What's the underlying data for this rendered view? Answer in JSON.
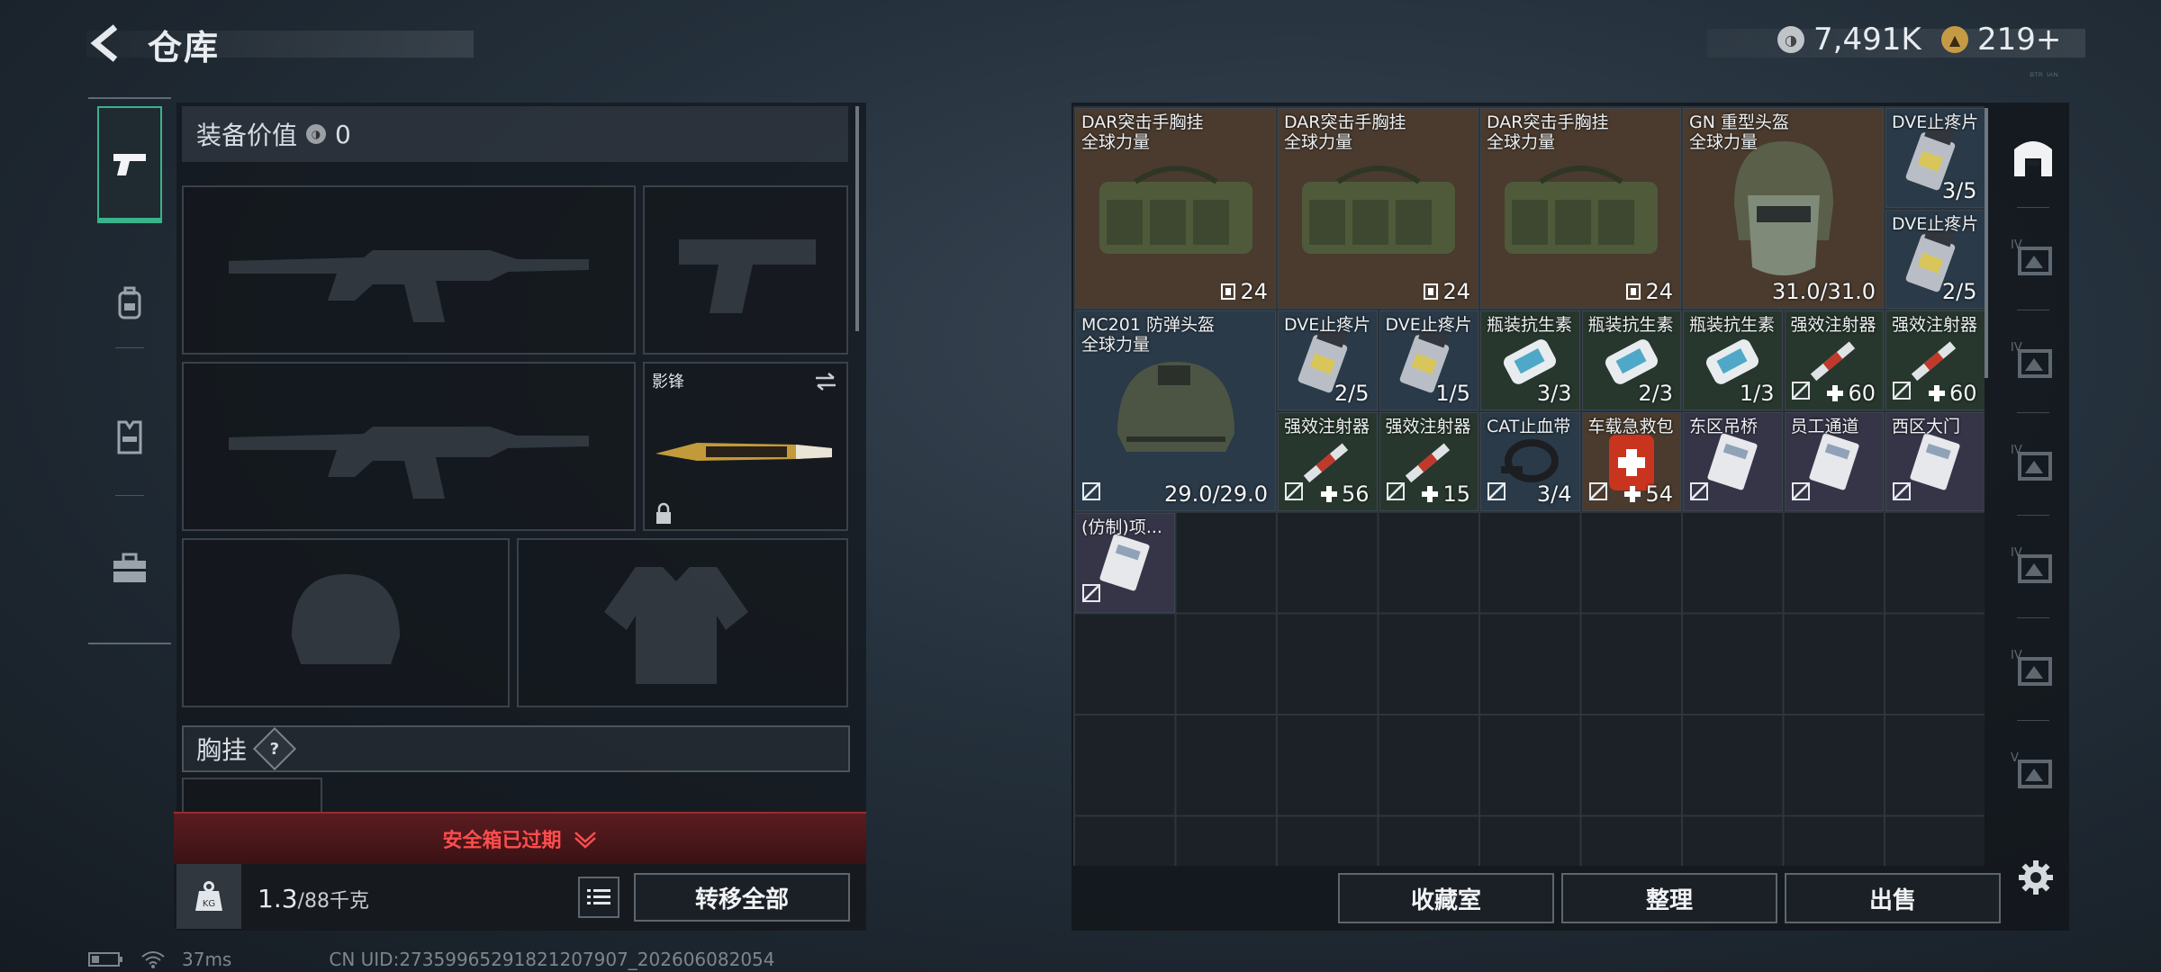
{
  "header": {
    "title": "仓库",
    "currency_coins": "7,491K",
    "currency_tokens": "219+",
    "top_tiny": "ᴮᵀᴿ ᴵᴬᴺ"
  },
  "left_rail": {
    "items": [
      {
        "name": "weapons",
        "icon": "pistol-icon",
        "active": true
      },
      {
        "name": "backpack",
        "icon": "backpack-icon",
        "active": false
      },
      {
        "name": "vest",
        "icon": "vest-icon",
        "active": false
      },
      {
        "name": "case",
        "icon": "briefcase-icon",
        "active": false
      }
    ]
  },
  "equipment": {
    "value_label": "装备价值",
    "value": "0",
    "melee_name": "影锋",
    "chest_label": "胸挂",
    "chest_help": "?",
    "safebox_expired": "安全箱已过期",
    "weight_value": "1.3",
    "weight_max": "/88千克",
    "transfer_all": "转移全部"
  },
  "status": {
    "ping": "37ms",
    "uid": "CN UID:27359965291821207907_202606082054"
  },
  "warehouse": {
    "items": [
      {
        "name": "DAR突击手胸挂",
        "sub": "全球力量",
        "count": "24",
        "kind": "bag"
      },
      {
        "name": "DAR突击手胸挂",
        "sub": "全球力量",
        "count": "24",
        "kind": "bag"
      },
      {
        "name": "DAR突击手胸挂",
        "sub": "全球力量",
        "count": "24",
        "kind": "bag"
      },
      {
        "name": "GN 重型头盔",
        "sub": "全球力量",
        "count": "31.0/31.0",
        "kind": "helmet-heavy"
      },
      {
        "name": "DVE止疼片",
        "count": "3/5",
        "kind": "pill"
      },
      {
        "name": "DVE止疼片",
        "count": "2/5",
        "kind": "pill"
      },
      {
        "name": "MC201 防弹头盔",
        "sub": "全球力量",
        "count": "29.0/29.0",
        "kind": "helmet"
      },
      {
        "name": "DVE止疼片",
        "count": "2/5",
        "kind": "pill"
      },
      {
        "name": "DVE止疼片",
        "count": "1/5",
        "kind": "pill"
      },
      {
        "name": "瓶装抗生素",
        "count": "3/3",
        "kind": "bottle"
      },
      {
        "name": "瓶装抗生素",
        "count": "2/3",
        "kind": "bottle"
      },
      {
        "name": "瓶装抗生素",
        "count": "1/3",
        "kind": "bottle"
      },
      {
        "name": "强效注射器",
        "count": "60",
        "kind": "syringe"
      },
      {
        "name": "强效注射器",
        "count": "60",
        "kind": "syringe"
      },
      {
        "name": "强效注射器",
        "count": "56",
        "kind": "syringe"
      },
      {
        "name": "强效注射器",
        "count": "15",
        "kind": "syringe"
      },
      {
        "name": "CAT止血带",
        "count": "3/4",
        "kind": "tourniquet"
      },
      {
        "name": "车载急救包",
        "count": "54",
        "kind": "medkit"
      },
      {
        "name": "东区吊桥",
        "count": "",
        "kind": "card"
      },
      {
        "name": "员工通道",
        "count": "",
        "kind": "card"
      },
      {
        "name": "西区大门",
        "count": "",
        "kind": "card"
      },
      {
        "name": "(仿制)项...",
        "count": "",
        "kind": "card"
      }
    ],
    "btn_collection": "收藏室",
    "btn_sort": "整理",
    "btn_sell": "出售"
  },
  "side_tabs": [
    {
      "name": "tab-all",
      "icon": "home-icon"
    },
    {
      "name": "tab-iv-1",
      "icon": "level-iv-icon"
    },
    {
      "name": "tab-iv-2",
      "icon": "level-iv-icon"
    },
    {
      "name": "tab-iv-3",
      "icon": "level-iv-icon"
    },
    {
      "name": "tab-iv-4",
      "icon": "level-iv-icon"
    },
    {
      "name": "tab-iv-5",
      "icon": "level-iv-icon"
    },
    {
      "name": "tab-v",
      "icon": "level-v-icon"
    }
  ],
  "colors": {
    "accent_green": "#3ab28a",
    "danger_red": "#ff4d4d",
    "tile_brown": "#4a3b2e",
    "tile_blue": "#2a3a48",
    "tile_green": "#27372d",
    "tile_purple": "#363548"
  }
}
